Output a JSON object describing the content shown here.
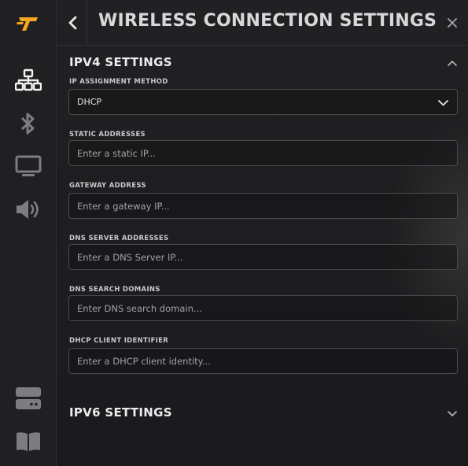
{
  "window": {
    "title": "WIRELESS CONNECTION SETTINGS",
    "back_icon": "chevron-left-icon",
    "close_icon": "close-icon"
  },
  "sidebar": {
    "logo": "logo-icon",
    "accent_color": "#f5a623",
    "items": [
      {
        "icon": "network-icon",
        "name": "network"
      },
      {
        "icon": "bluetooth-icon",
        "name": "bluetooth"
      },
      {
        "icon": "monitor-icon",
        "name": "display"
      },
      {
        "icon": "speaker-icon",
        "name": "sound"
      },
      {
        "icon": "storage-icon",
        "name": "storage"
      },
      {
        "icon": "book-icon",
        "name": "docs"
      }
    ]
  },
  "ipv4": {
    "title": "IPV4 SETTINGS",
    "expanded": true,
    "method": {
      "label": "IP ASSIGNMENT METHOD",
      "value": "DHCP"
    },
    "static": {
      "label": "STATIC ADDRESSES",
      "placeholder": "Enter a static IP..."
    },
    "gateway": {
      "label": "GATEWAY ADDRESS",
      "placeholder": "Enter a gateway IP..."
    },
    "dns": {
      "label": "DNS SERVER ADDRESSES",
      "placeholder": "Enter a DNS Server IP..."
    },
    "search": {
      "label": "DNS SEARCH DOMAINS",
      "placeholder": "Enter DNS search domain..."
    },
    "client_id": {
      "label": "DHCP CLIENT IDENTIFIER",
      "placeholder": "Enter a DHCP client identity..."
    }
  },
  "ipv6": {
    "title": "IPV6 SETTINGS",
    "expanded": false
  }
}
